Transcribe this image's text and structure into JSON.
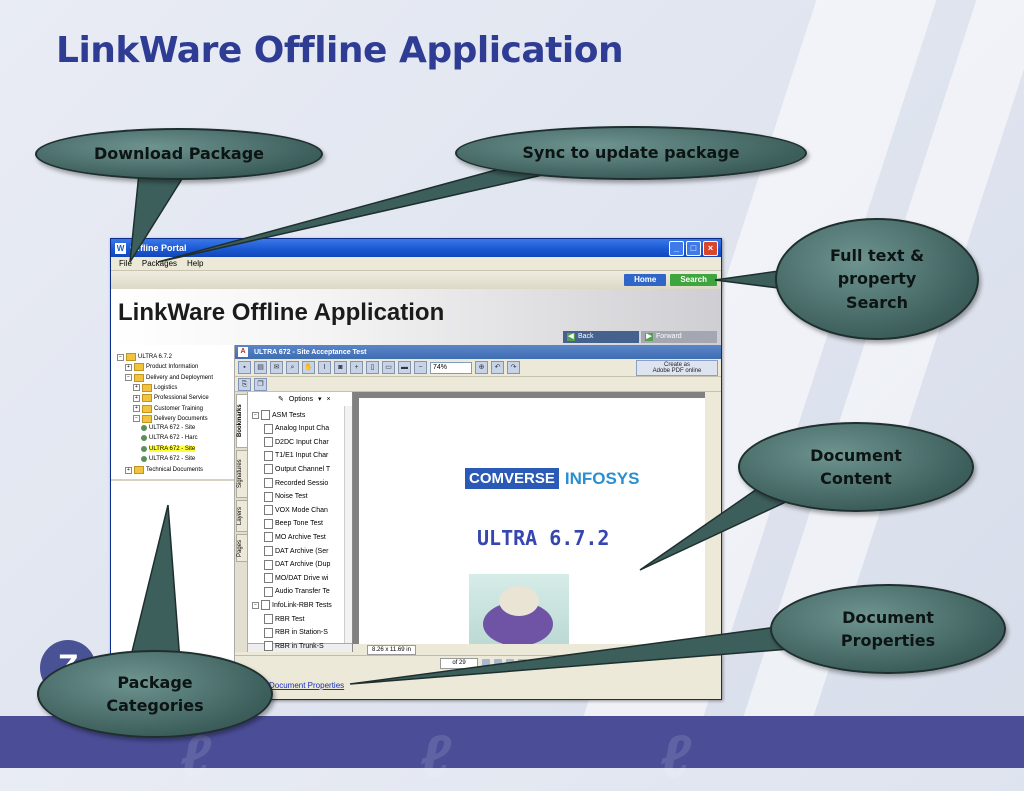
{
  "slide": {
    "title": "LinkWare Offline Application"
  },
  "callouts": {
    "download_package": "Download Package",
    "sync_update": "Sync to update package",
    "full_text_search": [
      "Full text &",
      "property",
      "Search"
    ],
    "document_content": [
      "Document",
      "Content"
    ],
    "document_properties": [
      "Document",
      "Properties"
    ],
    "package_categories": [
      "Package",
      "Categories"
    ]
  },
  "window": {
    "title": "Offline Portal",
    "menu": [
      "File",
      "Packages",
      "Help"
    ],
    "nav": {
      "home": "Home",
      "search": "Search"
    },
    "banner_title": "LinkWare Offline Application",
    "back": "Back",
    "forward": "Forward"
  },
  "tree": {
    "items": [
      {
        "label": "ULTRA 6.7.2",
        "level": 0,
        "kind": "folder",
        "exp": "-"
      },
      {
        "label": "Product Information",
        "level": 1,
        "kind": "folder",
        "exp": "+"
      },
      {
        "label": "Delivery and Deployment",
        "level": 1,
        "kind": "folder",
        "exp": "-"
      },
      {
        "label": "Logistics",
        "level": 2,
        "kind": "folder",
        "exp": "+"
      },
      {
        "label": "Professional Service",
        "level": 2,
        "kind": "folder",
        "exp": "+"
      },
      {
        "label": "Customer Training",
        "level": 2,
        "kind": "folder",
        "exp": "+"
      },
      {
        "label": "Delivery Documents",
        "level": 2,
        "kind": "folder",
        "exp": "-"
      },
      {
        "label": "ULTRA 672 - Site",
        "level": 3,
        "kind": "doc"
      },
      {
        "label": "ULTRA 672 - Harc",
        "level": 3,
        "kind": "doc"
      },
      {
        "label": "ULTRA 672 - Site",
        "level": 3,
        "kind": "doc",
        "selected": true
      },
      {
        "label": "ULTRA 672 - Site",
        "level": 3,
        "kind": "doc"
      },
      {
        "label": "Technical Documents",
        "level": 1,
        "kind": "folder",
        "exp": "+"
      }
    ]
  },
  "viewer": {
    "doc_title": "ULTRA 672 - Site Acceptance Test",
    "zoom": "74%",
    "create_pdf": [
      "Create as",
      "Adobe PDF online"
    ],
    "side_tabs": [
      "Bookmarks",
      "Signatures",
      "Layers",
      "Pages"
    ],
    "options": "Options",
    "close": "×",
    "bookmarks": [
      {
        "label": "ASM Tests",
        "level": 0,
        "exp": "-"
      },
      {
        "label": "Analog Input Cha",
        "level": 1
      },
      {
        "label": "D2DC Input Char",
        "level": 1
      },
      {
        "label": "T1/E1 Input Char",
        "level": 1
      },
      {
        "label": "Output Channel T",
        "level": 1
      },
      {
        "label": "Recorded Sessio",
        "level": 1
      },
      {
        "label": "Noise Test",
        "level": 1
      },
      {
        "label": "VOX Mode Chan",
        "level": 1
      },
      {
        "label": "Beep Tone Test",
        "level": 1
      },
      {
        "label": "MO Archive Test",
        "level": 1
      },
      {
        "label": "DAT Archive (Ser",
        "level": 1
      },
      {
        "label": "DAT Archive (Dup",
        "level": 1
      },
      {
        "label": "MO/DAT Drive wi",
        "level": 1
      },
      {
        "label": "Audio Transfer Te",
        "level": 1
      },
      {
        "label": "InfoLink-RBR Tests",
        "level": 0,
        "exp": "-"
      },
      {
        "label": "RBR Test",
        "level": 1
      },
      {
        "label": "RBR in Station-S",
        "level": 1
      },
      {
        "label": "RBR in Trunk-S",
        "level": 1
      }
    ],
    "doc_logo_left": "COMVERSE",
    "doc_logo_right": "INFOSYS",
    "doc_heading": "ULTRA 6.7.2",
    "page_size": "8.26 x 11.69 in",
    "page_of": "of 29",
    "properties_link": "Document Properties"
  },
  "colors": {
    "title": "#2f3c93",
    "callout": "#3d5f5c",
    "band": "#4b4e97"
  }
}
